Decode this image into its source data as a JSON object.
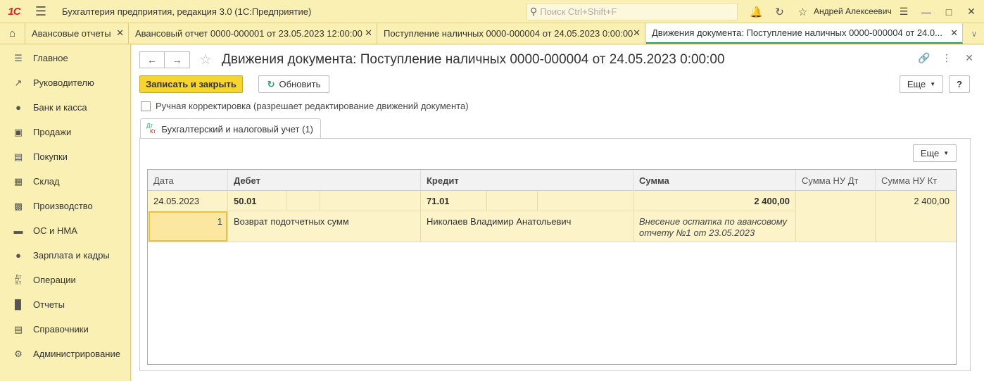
{
  "app": {
    "logo": "1С",
    "title": "Бухгалтерия предприятия, редакция 3.0  (1С:Предприятие)",
    "search_placeholder": "Поиск Ctrl+Shift+F",
    "user": "Андрей Алексеевич"
  },
  "tabs": [
    {
      "label": "Авансовые отчеты"
    },
    {
      "label": "Авансовый отчет 0000-000001 от 23.05.2023 12:00:00"
    },
    {
      "label": "Поступление наличных 0000-000004 от 24.05.2023 0:00:00"
    },
    {
      "label": "Движения документа: Поступление наличных 0000-000004 от 24.0..."
    }
  ],
  "sidebar": {
    "items": [
      {
        "label": "Главное",
        "icon": "menu-icon"
      },
      {
        "label": "Руководителю",
        "icon": "trend-icon"
      },
      {
        "label": "Банк и касса",
        "icon": "coin-icon"
      },
      {
        "label": "Продажи",
        "icon": "cart-icon"
      },
      {
        "label": "Покупки",
        "icon": "basket-icon"
      },
      {
        "label": "Склад",
        "icon": "warehouse-icon"
      },
      {
        "label": "Производство",
        "icon": "factory-icon"
      },
      {
        "label": "ОС и НМА",
        "icon": "truck-icon"
      },
      {
        "label": "Зарплата и кадры",
        "icon": "person-icon"
      },
      {
        "label": "Операции",
        "icon": "dt-kt-icon"
      },
      {
        "label": "Отчеты",
        "icon": "bar-chart-icon"
      },
      {
        "label": "Справочники",
        "icon": "book-icon"
      },
      {
        "label": "Администрирование",
        "icon": "gear-icon"
      }
    ]
  },
  "doc": {
    "title": "Движения документа: Поступление наличных 0000-000004 от 24.05.2023 0:00:00",
    "save_close": "Записать и закрыть",
    "refresh": "Обновить",
    "more": "Еще",
    "help": "?",
    "manual_edit": "Ручная корректировка (разрешает редактирование движений документа)",
    "subtab": "Бухгалтерский и налоговый учет (1)",
    "dt": "Дт",
    "kt": "Кт",
    "panel_more": "Еще"
  },
  "table": {
    "headers": [
      "Дата",
      "Дебет",
      "Кредит",
      "Сумма",
      "Сумма НУ Дт",
      "Сумма НУ Кт"
    ],
    "row": {
      "date": "24.05.2023",
      "number": "1",
      "debit_account": "50.01",
      "debit_subconto": "Возврат подотчетных сумм",
      "credit_account": "71.01",
      "credit_subconto": "Николаев Владимир Анатольевич",
      "sum": "2 400,00",
      "content": "Внесение остатка по авансовому отчету №1 от 23.05.2023",
      "sum_nu_kt": "2 400,00"
    }
  },
  "colors": {
    "accent_yellow": "#f7d531",
    "panel_yellow": "#fbf0b4",
    "active_tab_line": "#2c9b6d",
    "logo_red": "#d9261c"
  }
}
